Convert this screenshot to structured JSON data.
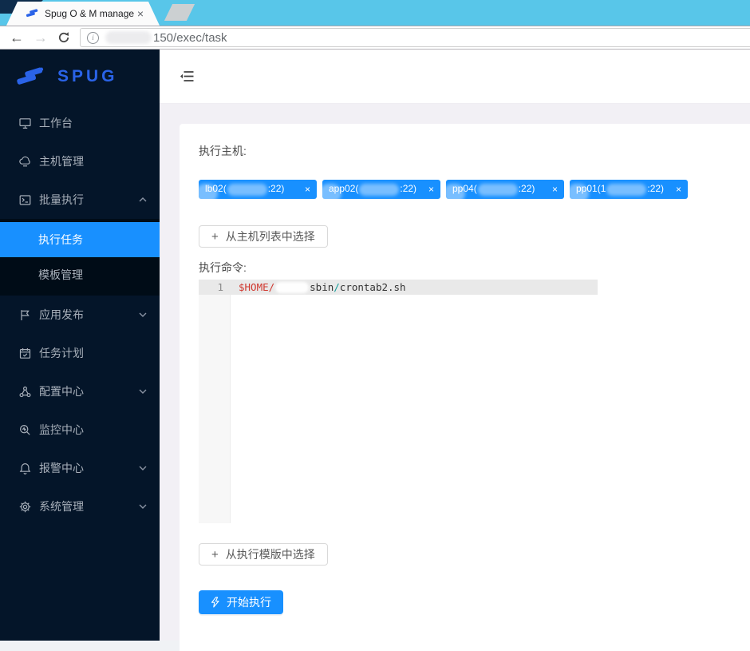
{
  "colors": {
    "accent": "#1890ff",
    "tabbar_bg": "#58c6e9",
    "sidebar_bg": "#041529",
    "submenu_bg": "#000c17",
    "content_bg": "#f2f0f5",
    "code_variable": "#d0382f",
    "logo_blue": "#2a63e8"
  },
  "browser": {
    "tab": {
      "title": "Spug O & M managem",
      "close_label": "×"
    },
    "url": {
      "visible_text": "150/exec/task"
    }
  },
  "sidebar": {
    "logo_text": "SPUG",
    "items": [
      {
        "label": "工作台",
        "icon": "desktop-icon"
      },
      {
        "label": "主机管理",
        "icon": "cloud-server-icon"
      },
      {
        "label": "批量执行",
        "icon": "code-icon",
        "expanded": true,
        "children": [
          {
            "label": "执行任务",
            "active": true
          },
          {
            "label": "模板管理",
            "active": false
          }
        ]
      },
      {
        "label": "应用发布",
        "icon": "flag-icon",
        "collapsed": true
      },
      {
        "label": "任务计划",
        "icon": "calendar-icon"
      },
      {
        "label": "配置中心",
        "icon": "deployment-icon",
        "collapsed": true
      },
      {
        "label": "监控中心",
        "icon": "monitor-icon"
      },
      {
        "label": "报警中心",
        "icon": "alert-icon",
        "collapsed": true
      },
      {
        "label": "系统管理",
        "icon": "setting-icon",
        "collapsed": true
      }
    ]
  },
  "main": {
    "exec_hosts_label": "执行主机:",
    "host_tags": [
      {
        "visible_name": "lb02(",
        "port_part": ":22)",
        "close": "×"
      },
      {
        "visible_name": "app02(",
        "port_part": ":22)",
        "close": "×"
      },
      {
        "visible_name": "pp04(",
        "port_part": ":22)",
        "close": "×"
      },
      {
        "visible_name": "pp01(1",
        "port_part": ":22)",
        "close": "×"
      }
    ],
    "select_host_button": "从主机列表中选择",
    "plus_glyph": "+",
    "exec_command_label": "执行命令:",
    "select_template_button": "从执行模版中选择",
    "start_button": "开始执行"
  },
  "editor": {
    "line_number": "1",
    "code_segments": [
      {
        "text": "$HOME/",
        "color": "#d0382f"
      },
      {
        "text": "sbin",
        "color": "#333333"
      },
      {
        "text": "/",
        "color": "#0e9b98"
      },
      {
        "text": "crontab2.sh",
        "color": "#333333"
      }
    ]
  }
}
